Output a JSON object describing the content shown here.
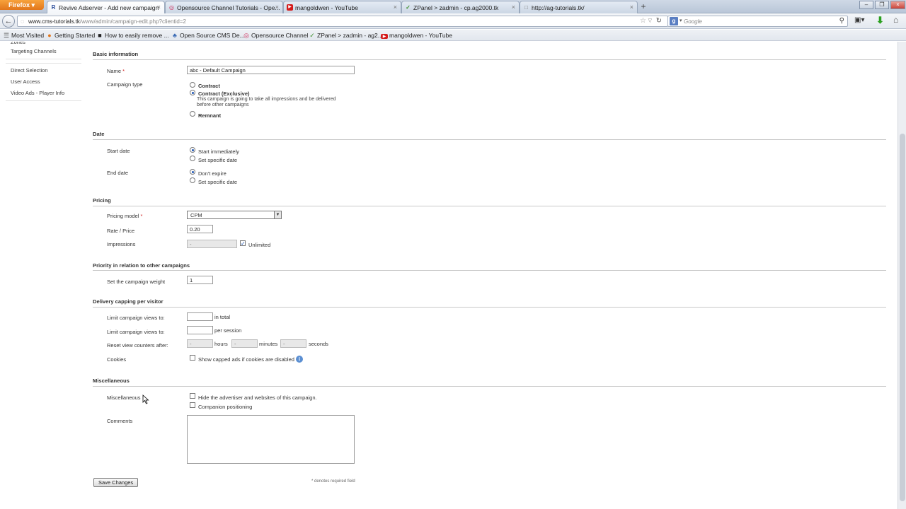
{
  "browser": {
    "menu_label": "Firefox",
    "tabs": [
      {
        "title": "Revive Adserver - Add new campaign",
        "favicon": "R"
      },
      {
        "title": "Opensource Channel Tutorials - Ope...",
        "favicon": "◎"
      },
      {
        "title": "mangoldwen - YouTube",
        "favicon": "▶"
      },
      {
        "title": "ZPanel > zadmin - cp.ag2000.tk",
        "favicon": "✓"
      },
      {
        "title": "http://ag-tutorials.tk/",
        "favicon": "□"
      }
    ],
    "url_host": "www.cms-tutorials.tk",
    "url_path": "/www/admin/campaign-edit.php?clientid=2",
    "search_placeholder": "Google",
    "bookmarks": [
      {
        "label": "Most Visited",
        "icon": "☰"
      },
      {
        "label": "Getting Started",
        "icon": "●"
      },
      {
        "label": "How to easily remove ...",
        "icon": "■"
      },
      {
        "label": "Open Source CMS De...",
        "icon": "♣"
      },
      {
        "label": "Opensource Channel",
        "icon": "◎"
      },
      {
        "label": "ZPanel > zadmin - ag2...",
        "icon": "✓"
      },
      {
        "label": "mangoldwen - YouTube",
        "icon": "▶"
      }
    ]
  },
  "sidebar": {
    "partial_item": "Zones",
    "items_top": [
      "Targeting Channels"
    ],
    "items_group2": [
      "Direct Selection",
      "User Access",
      "Video Ads - Player Info"
    ]
  },
  "form": {
    "basic": {
      "heading": "Basic information",
      "name_label": "Name",
      "required_mark": "*",
      "name_value": "abc - Default Campaign",
      "type_label": "Campaign type",
      "type_options": [
        "Contract",
        "Contract (Exclusive)",
        "Remnant"
      ],
      "exclusive_note": "This campaign is going to take all impressions and be delivered before other campaigns",
      "selected_type": "Contract (Exclusive)"
    },
    "date": {
      "heading": "Date",
      "start_label": "Start date",
      "start_options": [
        "Start immediately",
        "Set specific date"
      ],
      "end_label": "End date",
      "end_options": [
        "Don't expire",
        "Set specific date"
      ]
    },
    "pricing": {
      "heading": "Pricing",
      "model_label": "Pricing model",
      "model_value": "CPM",
      "rate_label": "Rate / Price",
      "rate_value": "0.20",
      "impressions_label": "Impressions",
      "impressions_value": "-",
      "unlimited_label": "Unlimited",
      "unlimited_checked": true
    },
    "priority": {
      "heading": "Priority in relation to other campaigns",
      "weight_label": "Set the campaign weight",
      "weight_value": "1"
    },
    "capping": {
      "heading": "Delivery capping per visitor",
      "limit_total_label": "Limit campaign views to:",
      "limit_total_suffix": "in total",
      "limit_session_label": "Limit campaign views to:",
      "limit_session_suffix": "per session",
      "reset_label": "Reset view counters after:",
      "hours_value": "-",
      "hours_suffix": "hours",
      "minutes_value": "-",
      "minutes_suffix": "minutes",
      "seconds_value": "-",
      "seconds_suffix": "seconds",
      "cookies_label": "Cookies",
      "cookies_option": "Show capped ads if cookies are disabled"
    },
    "misc": {
      "heading": "Miscellaneous",
      "misc_label": "Miscellaneous",
      "hide_option": "Hide the advertiser and websites of this campaign.",
      "companion_option": "Companion positioning",
      "comments_label": "Comments"
    },
    "save_label": "Save Changes",
    "required_note": "* denotes required field"
  },
  "colors": {
    "accent_radio": "#1e55b3",
    "required": "#d02020",
    "firefox_orange": "#e2761b"
  }
}
